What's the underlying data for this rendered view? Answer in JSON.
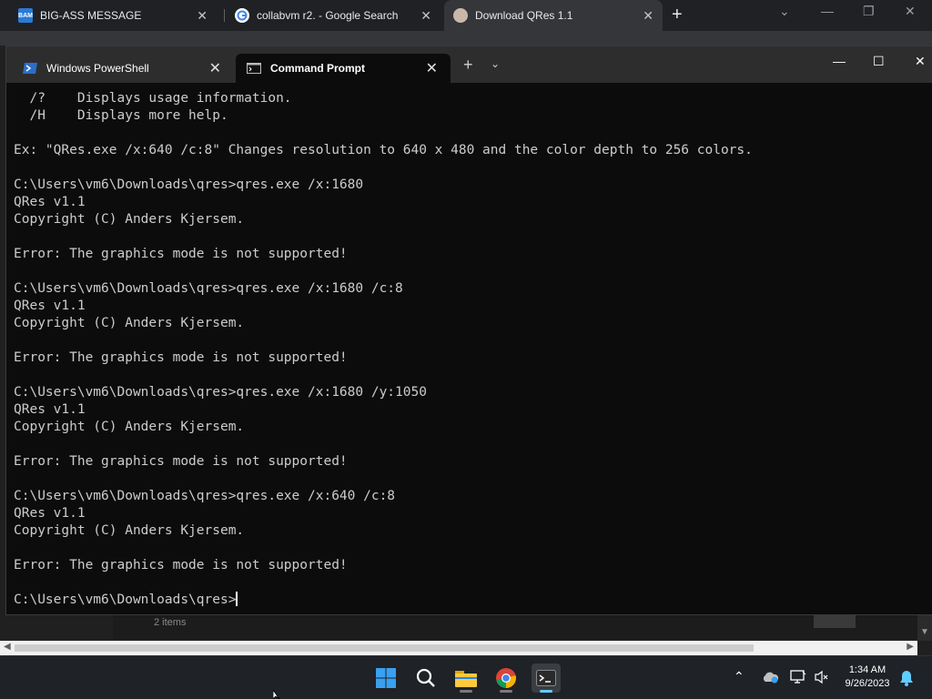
{
  "browser": {
    "tabs": [
      {
        "title": "BIG-ASS MESSAGE",
        "icon": "bam-favicon",
        "icon_text": "BAM"
      },
      {
        "title": "collabvm r2. - Google Search",
        "icon": "google-favicon"
      },
      {
        "title": "Download QRes 1.1",
        "icon": "site-favicon"
      }
    ]
  },
  "terminal": {
    "tabs": [
      {
        "title": "Windows PowerShell",
        "icon": "powershell-icon",
        "active": false
      },
      {
        "title": "Command Prompt",
        "icon": "cmd-icon",
        "active": true
      }
    ],
    "lines": [
      "  /?    Displays usage information.",
      "  /H    Displays more help.",
      "",
      "Ex: \"QRes.exe /x:640 /c:8\" Changes resolution to 640 x 480 and the color depth to 256 colors.",
      "",
      "C:\\Users\\vm6\\Downloads\\qres>qres.exe /x:1680",
      "QRes v1.1",
      "Copyright (C) Anders Kjersem.",
      "",
      "Error: The graphics mode is not supported!",
      "",
      "C:\\Users\\vm6\\Downloads\\qres>qres.exe /x:1680 /c:8",
      "QRes v1.1",
      "Copyright (C) Anders Kjersem.",
      "",
      "Error: The graphics mode is not supported!",
      "",
      "C:\\Users\\vm6\\Downloads\\qres>qres.exe /x:1680 /y:1050",
      "QRes v1.1",
      "Copyright (C) Anders Kjersem.",
      "",
      "Error: The graphics mode is not supported!",
      "",
      "C:\\Users\\vm6\\Downloads\\qres>qres.exe /x:640 /c:8",
      "QRes v1.1",
      "Copyright (C) Anders Kjersem.",
      "",
      "Error: The graphics mode is not supported!",
      ""
    ],
    "prompt": "C:\\Users\\vm6\\Downloads\\qres>"
  },
  "explorer": {
    "status": "2 items"
  },
  "taskbar": {
    "apps": [
      "start-button",
      "search-button",
      "file-explorer",
      "chrome",
      "terminal"
    ],
    "time": "1:34 AM",
    "date": "9/26/2023"
  },
  "colors": {
    "terminal_bg": "#0c0c0c",
    "terminal_text": "#cccccc",
    "accent": "#60cdff"
  }
}
